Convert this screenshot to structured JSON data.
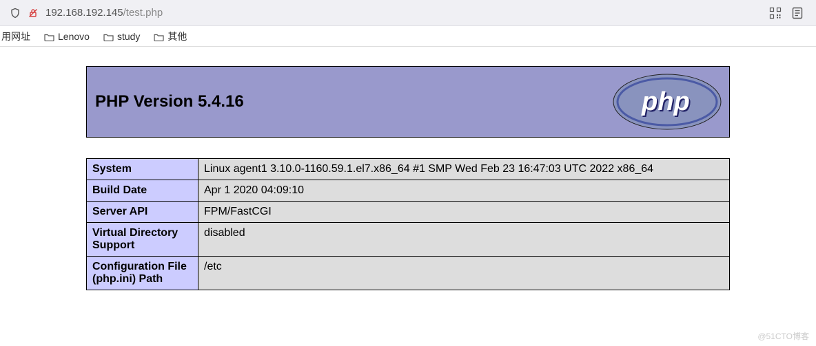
{
  "url": {
    "host": "192.168.192.145",
    "path": "/test.php"
  },
  "bookmarks": {
    "first_label": "用网址",
    "items": [
      "Lenovo",
      "study",
      "其他"
    ]
  },
  "phpinfo": {
    "title": "PHP Version 5.4.16",
    "rows": [
      {
        "key": "System",
        "value": "Linux agent1 3.10.0-1160.59.1.el7.x86_64 #1 SMP Wed Feb 23 16:47:03 UTC 2022 x86_64"
      },
      {
        "key": "Build Date",
        "value": "Apr 1 2020 04:09:10"
      },
      {
        "key": "Server API",
        "value": "FPM/FastCGI"
      },
      {
        "key": "Virtual Directory Support",
        "value": "disabled"
      },
      {
        "key": "Configuration File (php.ini) Path",
        "value": "/etc"
      }
    ]
  },
  "watermark": "@51CTO博客"
}
